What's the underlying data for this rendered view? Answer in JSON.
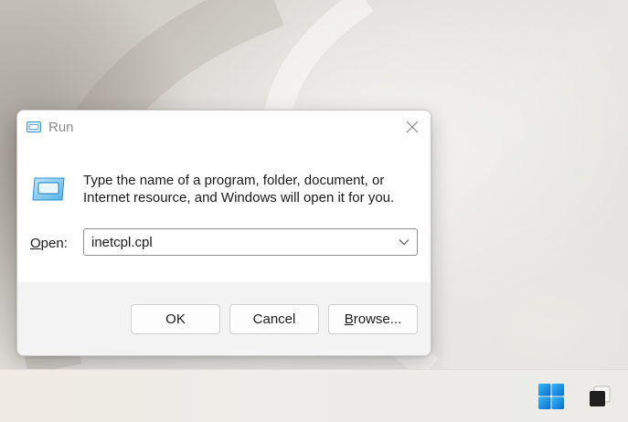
{
  "dialog": {
    "title": "Run",
    "description": "Type the name of a program, folder, document, or Internet resource, and Windows will open it for you.",
    "open_label_underlined": "O",
    "open_label_rest": "pen:",
    "open_value": "inetcpl.cpl",
    "ok_label": "OK",
    "cancel_label": "Cancel",
    "browse_label_underlined": "B",
    "browse_label_rest": "rowse..."
  },
  "taskbar": {
    "items": [
      "start-button",
      "task-view-button"
    ]
  },
  "colors": {
    "accent": "#0078d4",
    "dialog_bg": "#f3f3f3",
    "content_bg": "#ffffff"
  },
  "icons": [
    "run-app-icon",
    "close-icon",
    "chevron-down-icon",
    "windows-logo-icon",
    "task-view-icon"
  ]
}
